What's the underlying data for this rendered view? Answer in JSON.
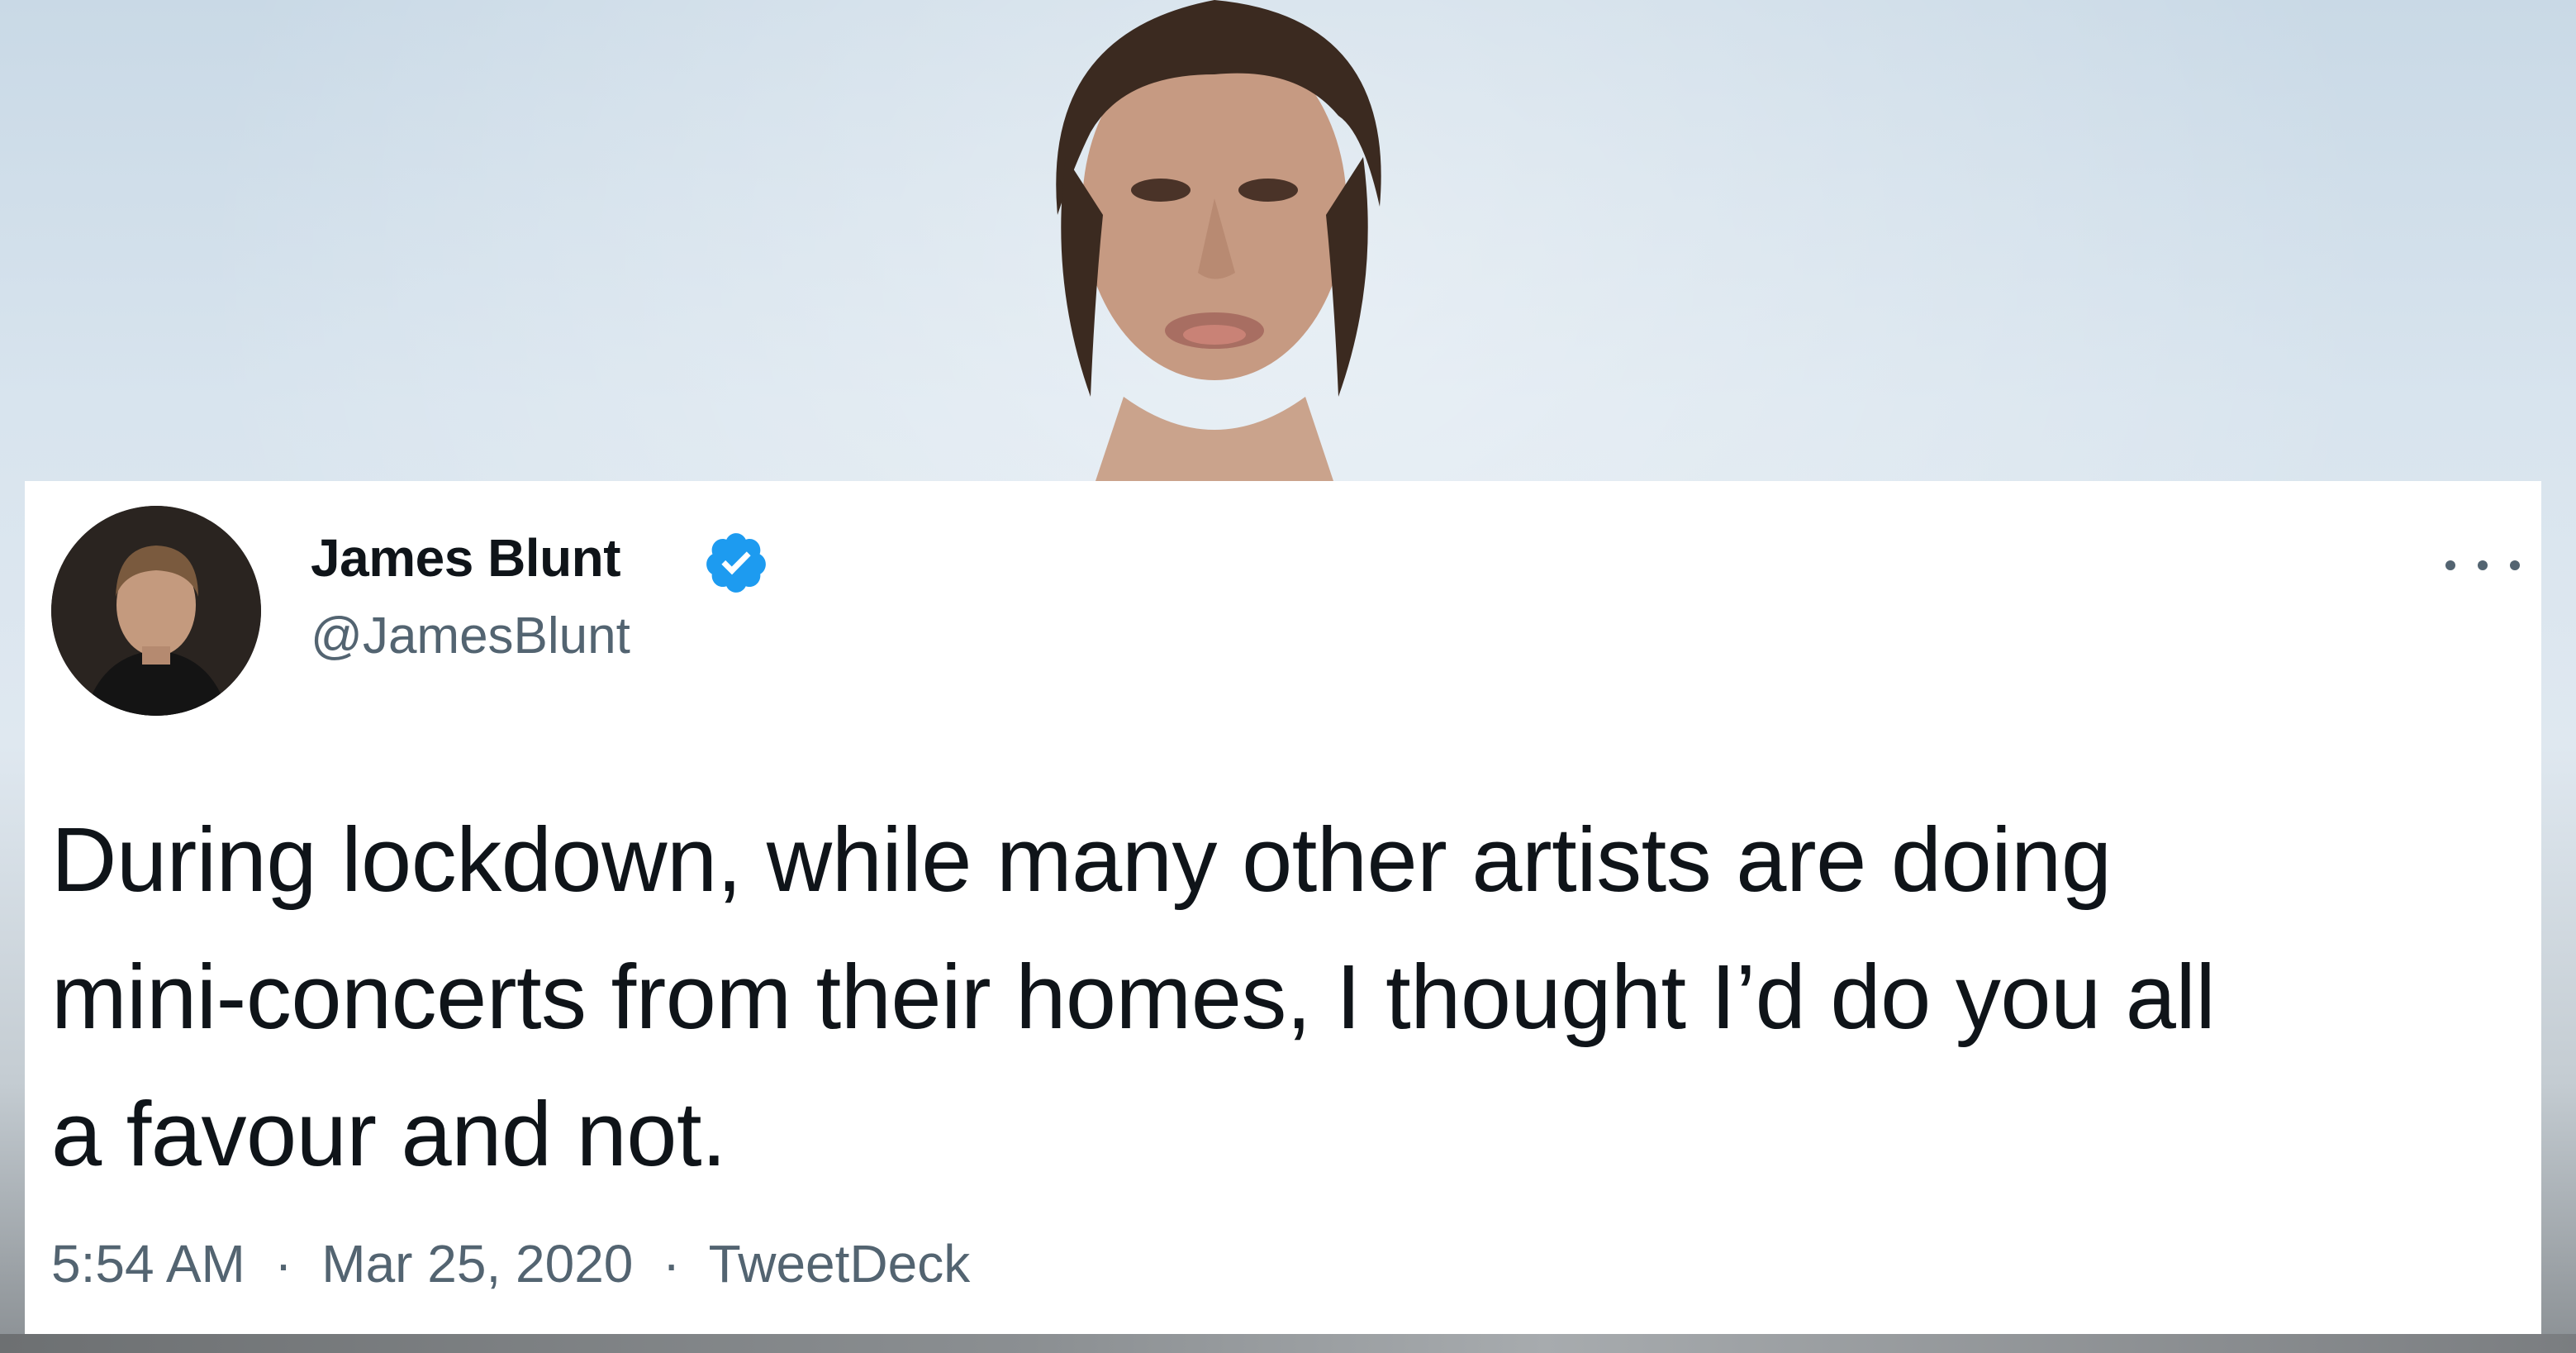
{
  "tweet": {
    "author": {
      "name": "James Blunt",
      "handle": "@JamesBlunt",
      "verified": true,
      "avatar_icon": "profile-photo"
    },
    "text_lines": [
      "During lockdown, while many other artists are doing",
      "mini-concerts from their homes, I thought I’d do you all",
      "a favour and not."
    ],
    "meta": {
      "time": "5:54 AM",
      "separator": "·",
      "date": "Mar 25, 2020",
      "source": "TweetDeck"
    },
    "more_icon": "more-horizontal-icon"
  },
  "colors": {
    "text_primary": "#0f1419",
    "text_secondary": "#536471",
    "verified_blue": "#1d9bf0",
    "card_background": "#ffffff"
  }
}
